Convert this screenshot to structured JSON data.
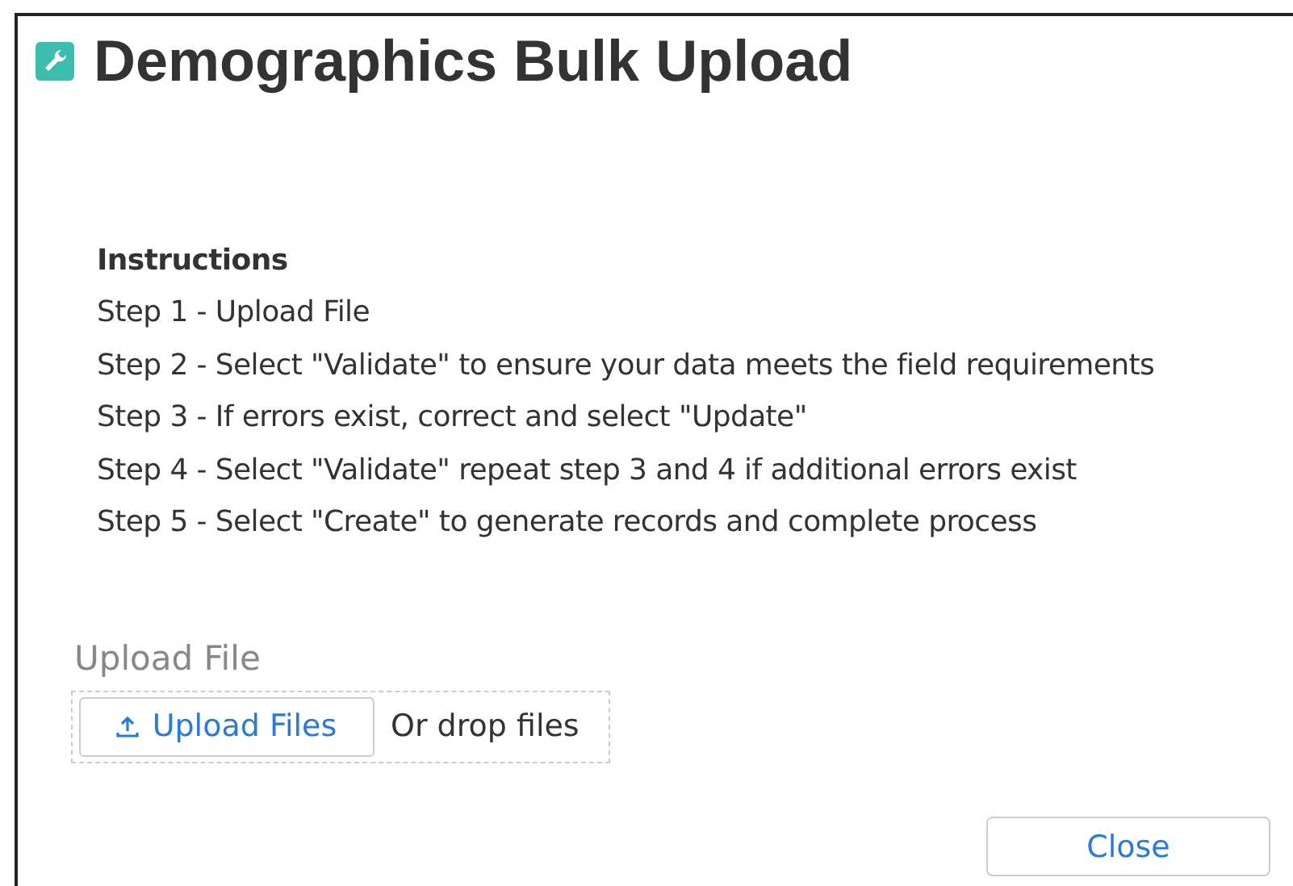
{
  "dialog": {
    "title": "Demographics Bulk Upload"
  },
  "instructions": {
    "heading": "Instructions",
    "steps": [
      "Step 1 - Upload File",
      "Step 2 - Select \"Validate\" to ensure your data meets the field requirements",
      "Step 3 - If errors exist, correct and select \"Update\"",
      "Step 4 - Select \"Validate\" repeat step 3 and 4 if additional errors exist",
      "Step 5 - Select \"Create\" to generate records and complete process"
    ]
  },
  "upload": {
    "label": "Upload File",
    "button": "Upload Files",
    "drop_hint": "Or drop files"
  },
  "buttons": [
    "Close"
  ]
}
